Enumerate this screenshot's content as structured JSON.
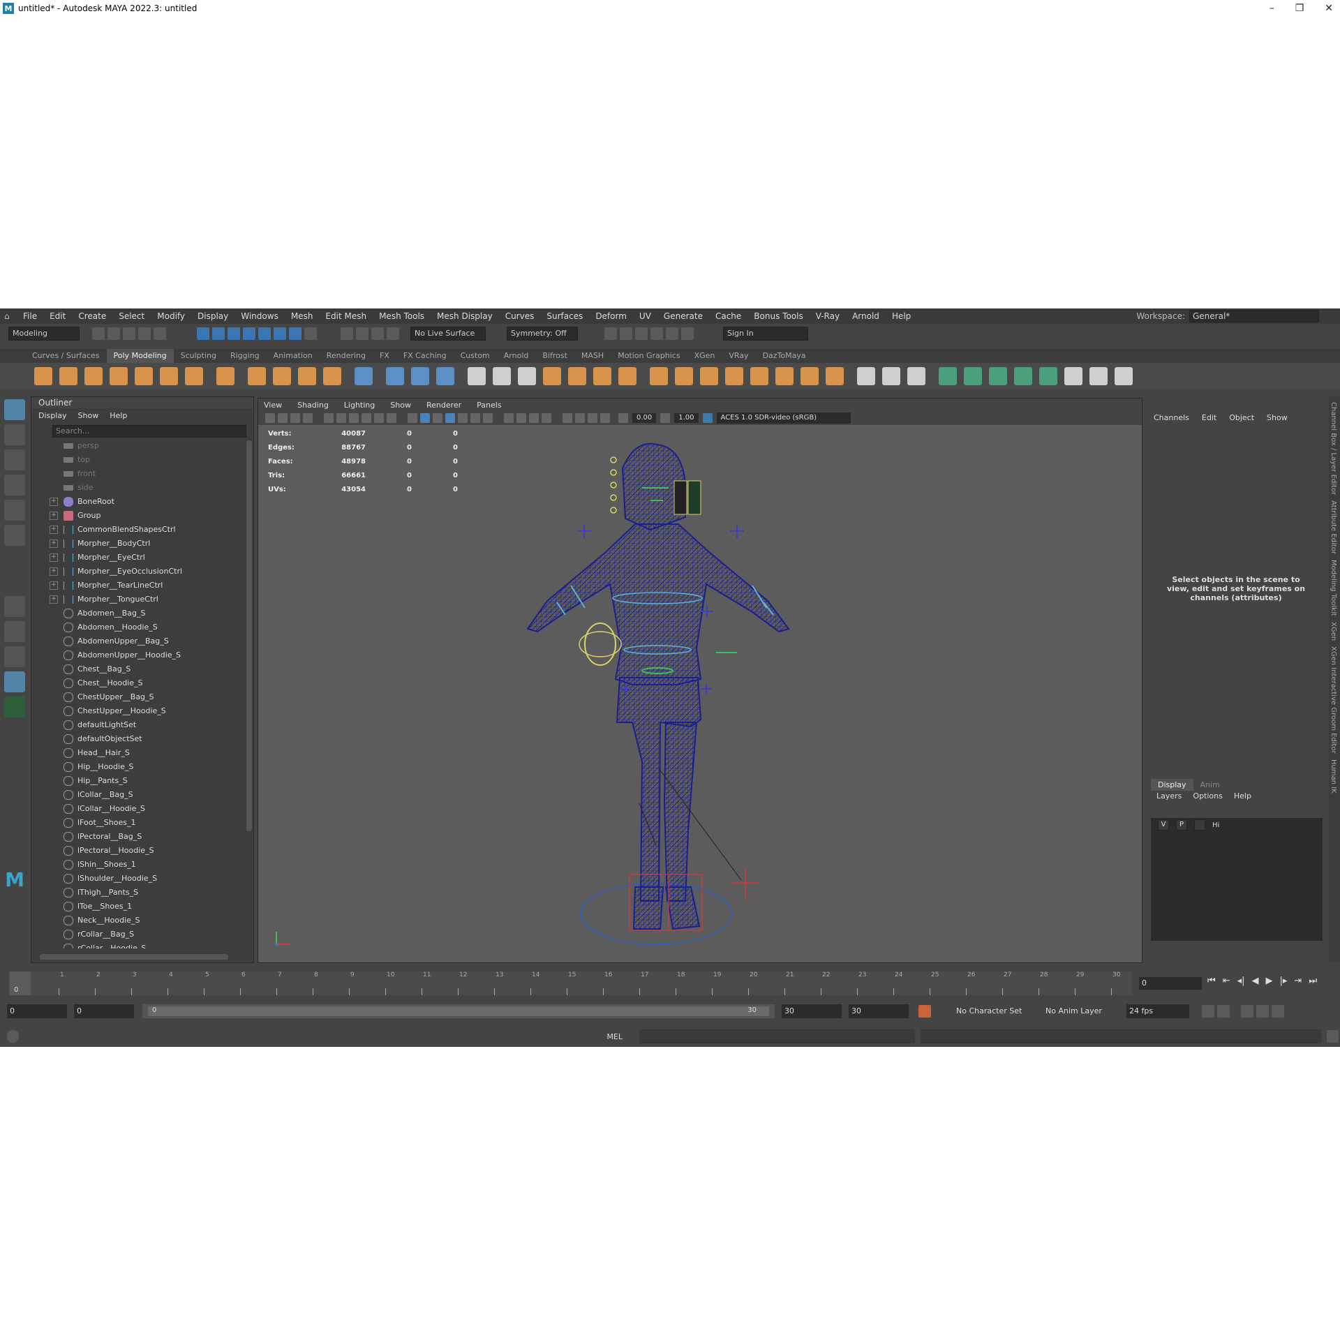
{
  "window": {
    "title": "untitled* - Autodesk MAYA 2022.3: untitled",
    "minimize": "–",
    "restore": "❐",
    "close": "✕"
  },
  "menu": [
    "File",
    "Edit",
    "Create",
    "Select",
    "Modify",
    "Display",
    "Windows",
    "Mesh",
    "Edit Mesh",
    "Mesh Tools",
    "Mesh Display",
    "Curves",
    "Surfaces",
    "Deform",
    "UV",
    "Generate",
    "Cache",
    "Bonus Tools",
    "V-Ray",
    "Arnold",
    "Help"
  ],
  "workspace": {
    "label": "Workspace:",
    "value": "General*"
  },
  "statusline": {
    "mode": "Modeling",
    "live_surface": "No Live Surface",
    "symmetry": "Symmetry: Off",
    "sign_in": "Sign In"
  },
  "shelf_tabs": [
    "Curves / Surfaces",
    "Poly Modeling",
    "Sculpting",
    "Rigging",
    "Animation",
    "Rendering",
    "FX",
    "FX Caching",
    "Custom",
    "Arnold",
    "Bifrost",
    "MASH",
    "Motion Graphics",
    "XGen",
    "VRay",
    "DazToMaya"
  ],
  "shelf_active": "Poly Modeling",
  "outliner": {
    "title": "Outliner",
    "menu": [
      "Display",
      "Show",
      "Help"
    ],
    "search_placeholder": "Search...",
    "items": [
      {
        "label": "persp",
        "kind": "cam"
      },
      {
        "label": "top",
        "kind": "cam"
      },
      {
        "label": "front",
        "kind": "cam"
      },
      {
        "label": "side",
        "kind": "cam"
      },
      {
        "label": "BoneRoot",
        "kind": "bone"
      },
      {
        "label": "Group",
        "kind": "grp"
      },
      {
        "label": "CommonBlendShapesCtrl",
        "kind": "ctrl"
      },
      {
        "label": "Morpher__BodyCtrl",
        "kind": "ctrl"
      },
      {
        "label": "Morpher__EyeCtrl",
        "kind": "ctrl"
      },
      {
        "label": "Morpher__EyeOcclusionCtrl",
        "kind": "ctrl"
      },
      {
        "label": "Morpher__TearLineCtrl",
        "kind": "ctrl"
      },
      {
        "label": "Morpher__TongueCtrl",
        "kind": "ctrl"
      },
      {
        "label": "Abdomen__Bag_S",
        "kind": "set"
      },
      {
        "label": "Abdomen__Hoodie_S",
        "kind": "set"
      },
      {
        "label": "AbdomenUpper__Bag_S",
        "kind": "set"
      },
      {
        "label": "AbdomenUpper__Hoodie_S",
        "kind": "set"
      },
      {
        "label": "Chest__Bag_S",
        "kind": "set"
      },
      {
        "label": "Chest__Hoodie_S",
        "kind": "set"
      },
      {
        "label": "ChestUpper__Bag_S",
        "kind": "set"
      },
      {
        "label": "ChestUpper__Hoodie_S",
        "kind": "set"
      },
      {
        "label": "defaultLightSet",
        "kind": "set"
      },
      {
        "label": "defaultObjectSet",
        "kind": "set"
      },
      {
        "label": "Head__Hair_S",
        "kind": "set"
      },
      {
        "label": "Hip__Hoodie_S",
        "kind": "set"
      },
      {
        "label": "Hip__Pants_S",
        "kind": "set"
      },
      {
        "label": "lCollar__Bag_S",
        "kind": "set"
      },
      {
        "label": "lCollar__Hoodie_S",
        "kind": "set"
      },
      {
        "label": "lFoot__Shoes_1",
        "kind": "set"
      },
      {
        "label": "lPectoral__Bag_S",
        "kind": "set"
      },
      {
        "label": "lPectoral__Hoodie_S",
        "kind": "set"
      },
      {
        "label": "lShin__Shoes_1",
        "kind": "set"
      },
      {
        "label": "lShoulder__Hoodie_S",
        "kind": "set"
      },
      {
        "label": "lThigh__Pants_S",
        "kind": "set"
      },
      {
        "label": "lToe__Shoes_1",
        "kind": "set"
      },
      {
        "label": "Neck__Hoodie_S",
        "kind": "set"
      },
      {
        "label": "rCollar__Bag_S",
        "kind": "set"
      },
      {
        "label": "rCollar__Hoodie_S",
        "kind": "set"
      }
    ]
  },
  "viewport": {
    "menu": [
      "View",
      "Shading",
      "Lighting",
      "Show",
      "Renderer",
      "Panels"
    ],
    "exposure": "0.00",
    "gamma": "1.00",
    "colorspace": "ACES 1.0 SDR-video (sRGB)",
    "hud": [
      {
        "k": "Verts:",
        "v": "40087",
        "a": "0",
        "b": "0"
      },
      {
        "k": "Edges:",
        "v": "88767",
        "a": "0",
        "b": "0"
      },
      {
        "k": "Faces:",
        "v": "48978",
        "a": "0",
        "b": "0"
      },
      {
        "k": "Tris:",
        "v": "66661",
        "a": "0",
        "b": "0"
      },
      {
        "k": "UVs:",
        "v": "43054",
        "a": "0",
        "b": "0"
      }
    ],
    "wire_color": "#1a1f8f"
  },
  "channel_box": {
    "menu": [
      "Channels",
      "Edit",
      "Object",
      "Show"
    ],
    "message": "Select objects in the scene to view, edit and set keyframes on channels (attributes)",
    "layer_tabs": [
      "Display",
      "Anim"
    ],
    "layer_menu": [
      "Layers",
      "Options",
      "Help"
    ],
    "layer_row": {
      "v": "V",
      "p": "P",
      "name": "Hi"
    }
  },
  "side_tabs": [
    "Channel Box / Layer Editor",
    "Attribute Editor",
    "Modeling Toolkit",
    "XGen",
    "XGen Interactive Groom Editor",
    "Human IK"
  ],
  "timeline": {
    "ticks": [
      "0",
      "1",
      "2",
      "3",
      "4",
      "5",
      "6",
      "7",
      "8",
      "9",
      "10",
      "11",
      "12",
      "13",
      "14",
      "15",
      "16",
      "17",
      "18",
      "19",
      "20",
      "21",
      "22",
      "23",
      "24",
      "25",
      "26",
      "27",
      "28",
      "29",
      "30"
    ],
    "current": "0",
    "current_field": "0"
  },
  "range": {
    "start": "0",
    "anim_start": "0",
    "slider_start": "0",
    "slider_end": "30",
    "end": "30",
    "anim_end": "30",
    "character_set": "No Character Set",
    "anim_layer": "No Anim Layer",
    "fps": "24 fps"
  },
  "command": {
    "label": "MEL"
  }
}
